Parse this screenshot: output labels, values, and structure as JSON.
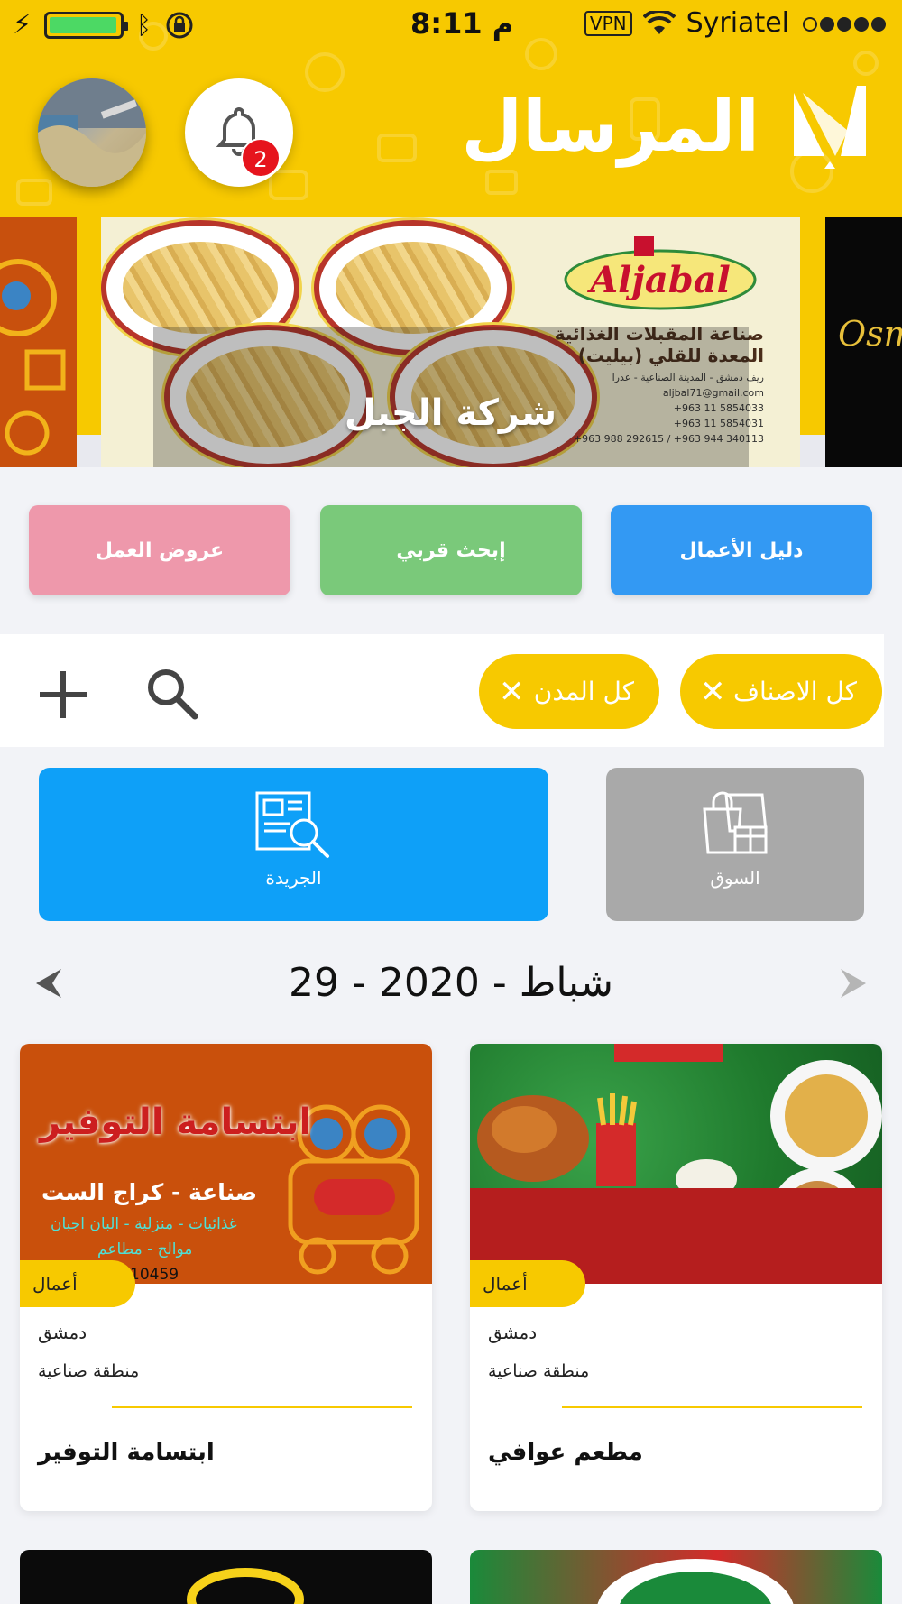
{
  "status_bar": {
    "time": "8:11 م",
    "vpn": "VPN",
    "carrier": "Syriatel"
  },
  "header": {
    "brand": "المرسال",
    "notifications_count": "2"
  },
  "banner": {
    "caption": "شركة الجبل",
    "logo_text": "Aljabal",
    "line1": "صناعة المقبلات الغذائية",
    "line2": "المعدة للقلي (بيليت)",
    "address": "ريف دمشق - المدينة الصناعية - عدرا",
    "email": "aljbal71@gmail.com",
    "phone1": "+963 11 5854033",
    "phone2": "+963 11 5854031",
    "mobiles": "+963 988 292615 / +963 944 340113",
    "next_slide_text": "Osm"
  },
  "quick_actions": {
    "job_offers": "عروض العمل",
    "search_nearby": "إبحث قربي",
    "business_directory": "دليل الأعمال"
  },
  "filters": {
    "cities_chip": "كل المدن",
    "categories_chip": "كل الاصناف",
    "clear_symbol": "✕"
  },
  "tiles": {
    "newspaper": "الجريدة",
    "market": "السوق"
  },
  "date_nav": {
    "date": "29 - شباط - 2020"
  },
  "cards": [
    {
      "tag": "أعمال",
      "city": "دمشق",
      "area": "منطقة صناعية",
      "name": "ابتسامة التوفير",
      "image_title": "ابتسامة التوفير",
      "image_sub": "صناعة - كراج الست",
      "image_small1": "غذائيات - منزلية - البان اجبان",
      "image_small2": "موالح - مطاعم",
      "image_phone": "10459"
    },
    {
      "tag": "أعمال",
      "city": "دمشق",
      "area": "منطقة صناعية",
      "name": "مطعم عوافي"
    }
  ],
  "colors": {
    "brand_yellow": "#f7c900",
    "blue": "#3399f3",
    "green": "#7ac97a",
    "pink": "#ee98ab",
    "news_blue": "#0ea0f8",
    "market_gray": "#a9a9a9"
  }
}
